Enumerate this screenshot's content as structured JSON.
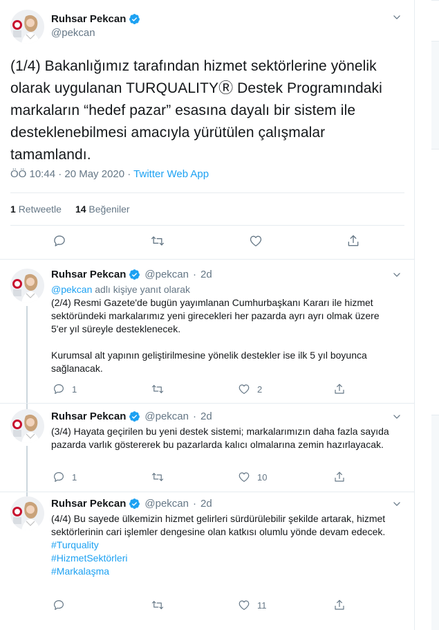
{
  "main_tweet": {
    "name": "Ruhsar Pekcan",
    "handle": "@pekcan",
    "text": "(1/4) Bakanlığımız tarafından hizmet sektörlerine yönelik olarak uygulanan TURQUALITYⓇ Destek Programındaki markaların “hedef pazar” esasına dayalı bir sistem ile desteklenebilmesi amacıyla yürütülen çalışmalar tamamlandı.",
    "time": "ÖÖ 10:44 · 20 May 2020 · ",
    "app": "Twitter Web App",
    "retweet_count": "1",
    "retweet_label": "Retweetle",
    "like_count": "14",
    "like_label": "Beğeniler"
  },
  "replies": [
    {
      "name": "Ruhsar Pekcan",
      "handle": "@pekcan",
      "dot": "·",
      "age": "2d",
      "reply_to_handle": "@pekcan",
      "reply_to_suffix": " adlı kişiye yanıt olarak",
      "para1": "(2/4) Resmi Gazete'de bugün yayımlanan Cumhurbaşkanı Kararı ile hizmet sektöründeki markalarımız yeni girecekleri her pazarda ayrı ayrı olmak üzere 5'er yıl süreyle desteklenecek.",
      "para2": "Kurumsal alt yapının geliştirilmesine yönelik destekler ise ilk 5 yıl boyunca sağlanacak.",
      "reply_count": "1",
      "retweet_count": "",
      "like_count": "2"
    },
    {
      "name": "Ruhsar Pekcan",
      "handle": "@pekcan",
      "dot": "·",
      "age": "2d",
      "para1": "(3/4) Hayata geçirilen bu yeni destek sistemi; markalarımızın daha fazla sayıda pazarda varlık göstererek bu pazarlarda kalıcı olmalarına zemin hazırlayacak.",
      "reply_count": "1",
      "retweet_count": "",
      "like_count": "10"
    },
    {
      "name": "Ruhsar Pekcan",
      "handle": "@pekcan",
      "dot": "·",
      "age": "2d",
      "para1": "(4/4) Bu sayede ülkemizin hizmet gelirleri sürdürülebilir şekilde artarak, hizmet sektörlerinin cari işlemler dengesine olan katkısı olumlu yönde devam edecek.",
      "hashtags": [
        "#Turquality",
        "#HizmetSektörleri",
        "#Markalaşma"
      ],
      "reply_count": "",
      "retweet_count": "",
      "like_count": "11"
    }
  ],
  "icons": {
    "verified": "verified-badge-icon",
    "caret": "chevron-down-icon",
    "reply": "reply-icon",
    "retweet": "retweet-icon",
    "like": "heart-icon",
    "share": "share-icon"
  },
  "colors": {
    "accent": "#1da1f2",
    "secondary_text": "#657786",
    "primary_text": "#14171a",
    "border": "#e6ecf0",
    "thread_line": "#ccd6dd"
  }
}
